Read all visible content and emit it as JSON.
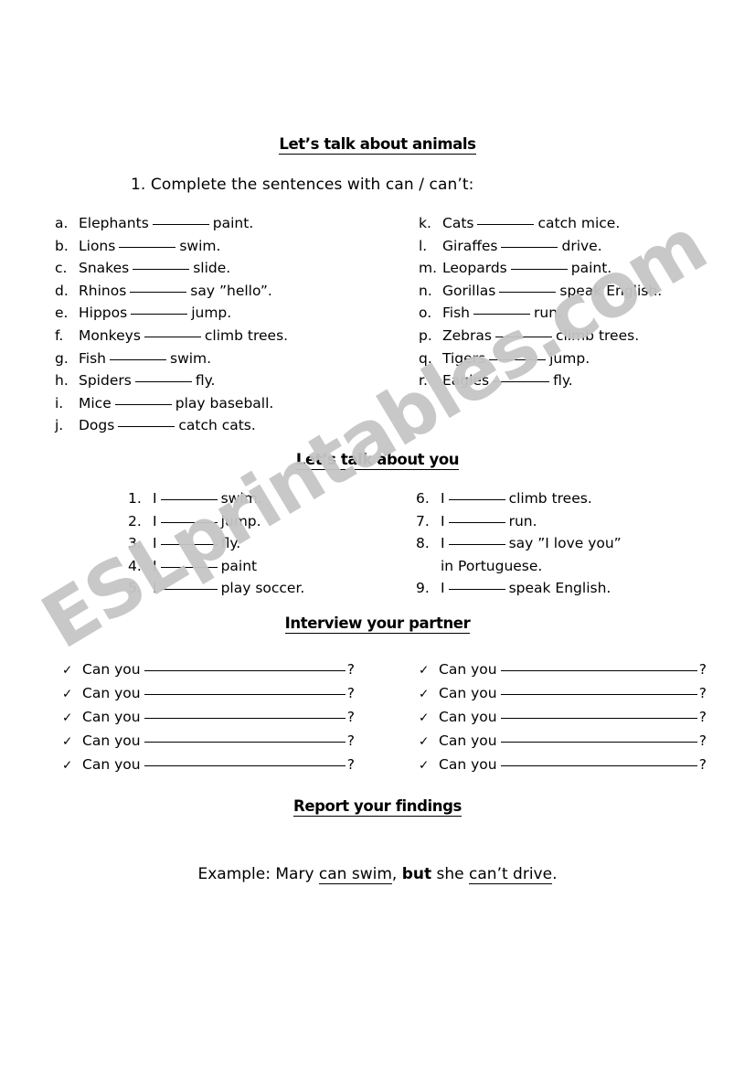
{
  "document": {
    "watermark": "ESLprintables.com",
    "watermark_color": "#c6c6c6"
  },
  "section_animals": {
    "heading": "Let’s talk about animals",
    "instruction": "1. Complete the sentences with can / can’t:",
    "left_items": [
      {
        "marker": "a.",
        "before": "Elephants",
        "after": "paint."
      },
      {
        "marker": "b.",
        "before": "Lions",
        "after": "swim."
      },
      {
        "marker": "c.",
        "before": "Snakes",
        "after": "slide."
      },
      {
        "marker": "d.",
        "before": "Rhinos",
        "after": "say ”hello”."
      },
      {
        "marker": "e.",
        "before": "Hippos",
        "after": "jump."
      },
      {
        "marker": "f.",
        "before": "Monkeys",
        "after": "climb trees."
      },
      {
        "marker": "g.",
        "before": "Fish",
        "after": "swim."
      },
      {
        "marker": "h.",
        "before": "Spiders",
        "after": "fly."
      },
      {
        "marker": "i.",
        "before": "Mice",
        "after": "play baseball."
      },
      {
        "marker": "j.",
        "before": "Dogs",
        "after": "catch cats."
      }
    ],
    "right_items": [
      {
        "marker": "k.",
        "before": "Cats",
        "after": "catch mice."
      },
      {
        "marker": "l.",
        "before": "Giraffes",
        "after": "drive."
      },
      {
        "marker": "m.",
        "before": "Leopards",
        "after": "paint."
      },
      {
        "marker": "n.",
        "before": "Gorillas",
        "after": "speak English."
      },
      {
        "marker": "o.",
        "before": "Fish",
        "after": "run."
      },
      {
        "marker": "p.",
        "before": "Zebras",
        "after": "climb trees."
      },
      {
        "marker": "q.",
        "before": "Tigers",
        "after": "jump."
      },
      {
        "marker": "r.",
        "before": "Eagles",
        "after": "fly."
      }
    ]
  },
  "section_you": {
    "heading": "Let’s talk about you",
    "left_items": [
      {
        "marker": "1.",
        "before": "I",
        "after": "swim."
      },
      {
        "marker": "2.",
        "before": "I",
        "after": "jump."
      },
      {
        "marker": "3.",
        "before": "I",
        "after": "fly."
      },
      {
        "marker": "4.",
        "before": "I",
        "after": "paint"
      },
      {
        "marker": "5.",
        "before": "I",
        "after": "play soccer."
      }
    ],
    "right_items": [
      {
        "marker": "6.",
        "before": "I",
        "after": "climb trees.",
        "continuation": ""
      },
      {
        "marker": "7.",
        "before": "I",
        "after": "run.",
        "continuation": ""
      },
      {
        "marker": "8.",
        "before": "I",
        "after": "say ”I love you”",
        "continuation": "in Portuguese."
      },
      {
        "marker": "9.",
        "before": "I",
        "after": "speak English.",
        "continuation": ""
      }
    ]
  },
  "section_interview": {
    "heading": "Interview your partner",
    "check_icon": "✓",
    "left_rows": [
      {
        "label": "Can you",
        "question_mark": "?"
      },
      {
        "label": "Can you",
        "question_mark": "?"
      },
      {
        "label": "Can you",
        "question_mark": "?"
      },
      {
        "label": "Can you",
        "question_mark": "?"
      },
      {
        "label": "Can you",
        "question_mark": "?"
      }
    ],
    "right_rows": [
      {
        "label": "Can you",
        "question_mark": "?"
      },
      {
        "label": "Can you",
        "question_mark": "?"
      },
      {
        "label": "Can you",
        "question_mark": "?"
      },
      {
        "label": "Can you",
        "question_mark": "?"
      },
      {
        "label": "Can you",
        "question_mark": "?"
      }
    ]
  },
  "section_report": {
    "heading": "Report your findings",
    "example_prefix": "Example: Mary ",
    "example_u1": "can swim",
    "example_mid1": ", ",
    "example_bold": "but",
    "example_mid2": " she ",
    "example_u2": "can’t drive",
    "example_suffix": "."
  }
}
